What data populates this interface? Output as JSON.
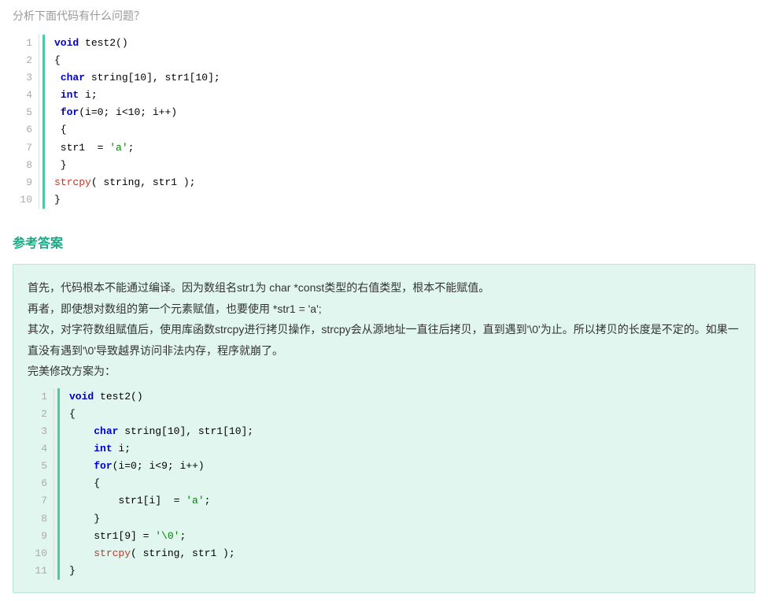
{
  "question": "分析下面代码有什么问题？",
  "code1": {
    "lines": [
      "1",
      "2",
      "3",
      "4",
      "5",
      "6",
      "7",
      "8",
      "9",
      "10"
    ],
    "tokens": [
      [
        {
          "t": "void ",
          "c": "type"
        },
        {
          "t": "test2()",
          "c": "plain"
        }
      ],
      [
        {
          "t": "{",
          "c": "plain"
        }
      ],
      [
        {
          "t": " ",
          "c": "plain"
        },
        {
          "t": "char",
          "c": "type"
        },
        {
          "t": " string[",
          "c": "plain"
        },
        {
          "t": "10",
          "c": "num"
        },
        {
          "t": "], str1[",
          "c": "plain"
        },
        {
          "t": "10",
          "c": "num"
        },
        {
          "t": "];",
          "c": "plain"
        }
      ],
      [
        {
          "t": " ",
          "c": "plain"
        },
        {
          "t": "int",
          "c": "type"
        },
        {
          "t": " i;",
          "c": "plain"
        }
      ],
      [
        {
          "t": " ",
          "c": "plain"
        },
        {
          "t": "for",
          "c": "kw"
        },
        {
          "t": "(i=",
          "c": "plain"
        },
        {
          "t": "0",
          "c": "num"
        },
        {
          "t": "; i<",
          "c": "plain"
        },
        {
          "t": "10",
          "c": "num"
        },
        {
          "t": "; i++)",
          "c": "plain"
        }
      ],
      [
        {
          "t": " {",
          "c": "plain"
        }
      ],
      [
        {
          "t": " str1  = ",
          "c": "plain"
        },
        {
          "t": "'a'",
          "c": "str"
        },
        {
          "t": ";",
          "c": "plain"
        }
      ],
      [
        {
          "t": " }",
          "c": "plain"
        }
      ],
      [
        {
          "t": "strcpy",
          "c": "fn"
        },
        {
          "t": "( string, str1 );",
          "c": "plain"
        }
      ],
      [
        {
          "t": "}",
          "c": "plain"
        }
      ]
    ]
  },
  "answer_title": "参考答案",
  "answer_paragraphs": [
    "首先，代码根本不能通过编译。因为数组名str1为 char *const类型的右值类型，根本不能赋值。",
    "再者，即使想对数组的第一个元素赋值，也要使用 *str1 = 'a';",
    "其次，对字符数组赋值后，使用库函数strcpy进行拷贝操作，strcpy会从源地址一直往后拷贝，直到遇到'\\0'为止。所以拷贝的长度是不定的。如果一直没有遇到'\\0'导致越界访问非法内存，程序就崩了。",
    "完美修改方案为："
  ],
  "code2": {
    "lines": [
      "1",
      "2",
      "3",
      "4",
      "5",
      "6",
      "7",
      "8",
      "9",
      "10",
      "11"
    ],
    "tokens": [
      [
        {
          "t": "void ",
          "c": "type"
        },
        {
          "t": "test2()",
          "c": "plain"
        }
      ],
      [
        {
          "t": "{",
          "c": "plain"
        }
      ],
      [
        {
          "t": "    ",
          "c": "plain"
        },
        {
          "t": "char",
          "c": "type"
        },
        {
          "t": " string[",
          "c": "plain"
        },
        {
          "t": "10",
          "c": "num"
        },
        {
          "t": "], str1[",
          "c": "plain"
        },
        {
          "t": "10",
          "c": "num"
        },
        {
          "t": "];",
          "c": "plain"
        }
      ],
      [
        {
          "t": "    ",
          "c": "plain"
        },
        {
          "t": "int",
          "c": "type"
        },
        {
          "t": " i;",
          "c": "plain"
        }
      ],
      [
        {
          "t": "    ",
          "c": "plain"
        },
        {
          "t": "for",
          "c": "kw"
        },
        {
          "t": "(i=",
          "c": "plain"
        },
        {
          "t": "0",
          "c": "num"
        },
        {
          "t": "; i<",
          "c": "plain"
        },
        {
          "t": "9",
          "c": "num"
        },
        {
          "t": "; i++)",
          "c": "plain"
        }
      ],
      [
        {
          "t": "    {",
          "c": "plain"
        }
      ],
      [
        {
          "t": "        str1[i]  = ",
          "c": "plain"
        },
        {
          "t": "'a'",
          "c": "str"
        },
        {
          "t": ";",
          "c": "plain"
        }
      ],
      [
        {
          "t": "    }",
          "c": "plain"
        }
      ],
      [
        {
          "t": "    str1[",
          "c": "plain"
        },
        {
          "t": "9",
          "c": "num"
        },
        {
          "t": "] = ",
          "c": "plain"
        },
        {
          "t": "'\\0'",
          "c": "str"
        },
        {
          "t": ";",
          "c": "plain"
        }
      ],
      [
        {
          "t": "    ",
          "c": "plain"
        },
        {
          "t": "strcpy",
          "c": "fn"
        },
        {
          "t": "( string, str1 );",
          "c": "plain"
        }
      ],
      [
        {
          "t": "}",
          "c": "plain"
        }
      ]
    ]
  }
}
